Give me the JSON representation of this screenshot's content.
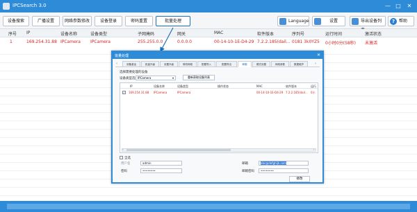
{
  "app": {
    "title": "IPCSearch 3.0"
  },
  "window_controls": {
    "minimize": "—",
    "maximize": "□",
    "close": "✕"
  },
  "toolbar": {
    "buttons": [
      "设备搜索",
      "广播设置",
      "网络参数修改",
      "设备登录",
      "密码重置",
      "批量处理"
    ],
    "language_label": "Language",
    "settings_label": "设置",
    "export_label": "导出设备列表",
    "help_label": "帮助"
  },
  "grid": {
    "columns": [
      "序号",
      "IP",
      "设备名称",
      "设备类型",
      "子网掩码",
      "网关",
      "MAC",
      "软件版本",
      "序列号",
      "运行时间",
      "激活状态"
    ],
    "rows": [
      [
        "1",
        "169.254.31.88",
        "IPCamera",
        "IPCamera",
        "255.255.0.0",
        "0.0.0.0",
        "00-14-10-1E-D4-29",
        "7.2.2.185(dail...",
        "0181 3k0YZ5",
        "0小时0分(58秒)",
        "未激活"
      ]
    ]
  },
  "dialog": {
    "title": "批量处理",
    "close": "✕",
    "tabs": [
      "设备激活",
      "批量升级",
      "设置升级",
      "修改网络",
      "配置导入",
      "配置导出",
      "邮箱",
      "模式设置",
      "网络参数",
      "数据维护"
    ],
    "active_tab": 6,
    "chev_left": "‹",
    "chev_right": "›",
    "section_label": "选择需要处理的设备",
    "select_label": "设备类型选择",
    "select_value": "IPCamera",
    "select_caret": "▾",
    "reload_button": "重新获取设备列表",
    "table": {
      "columns": [
        "IP",
        "设备名称",
        "设备类型",
        "操作状态",
        "MAC",
        "软件版本",
        "运行"
      ],
      "rows": [
        [
          "169.254.31.88",
          "IPCamera",
          "IPCamera",
          "",
          "00-14-10-1E-D4-29",
          "7.2.2.185(dail...",
          "0小"
        ]
      ],
      "row_checked": "✓",
      "scroll_left": "‹",
      "scroll_right": "›"
    },
    "select_all_label": "全选",
    "form": {
      "username_label": "用户名",
      "username_value": "admin",
      "password_label": "密码",
      "password_value": "••••••••",
      "email_label": "邮箱",
      "email_value": "abc@defghijk.com",
      "email_password_label": "邮箱密码",
      "email_password_value": "••••••••",
      "modify_button": "修改"
    }
  }
}
